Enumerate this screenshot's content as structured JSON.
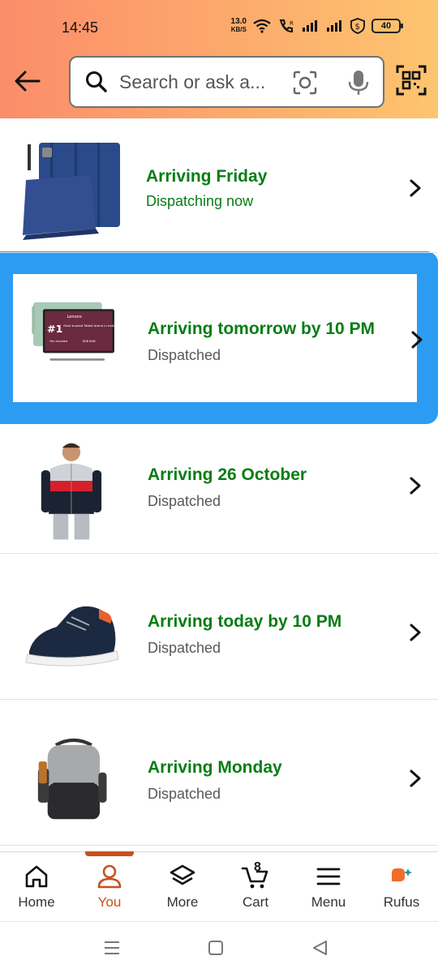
{
  "status_bar": {
    "time": "14:45",
    "net_speed_value": "13.0",
    "net_speed_unit": "KB/S",
    "battery": "40"
  },
  "search": {
    "placeholder": "Search or ask a..."
  },
  "orders": [
    {
      "title": "Arriving Friday",
      "subtitle": "Dispatching now",
      "subtitle_color": "#067d14",
      "thumb": "tablet-case"
    },
    {
      "title": "Arriving tomorrow by 10 PM",
      "subtitle": "Dispatched",
      "thumb": "lenovo-tablet",
      "thumb_text_brand": "Lenovo",
      "thumb_text_rank": "#1",
      "thumb_text_tagline": "Most trusted Tablet brand in India",
      "thumb_text_pen": "Pen Included",
      "thumb_text_ram": "8GB RAM"
    },
    {
      "title": "Arriving 26 October",
      "subtitle": "Dispatched",
      "thumb": "hoodie"
    },
    {
      "title": "Arriving today by 10 PM",
      "subtitle": "Dispatched",
      "thumb": "sneaker"
    },
    {
      "title": "Arriving Monday",
      "subtitle": "Dispatched",
      "thumb": "backpack"
    }
  ],
  "bottom_nav": [
    {
      "label": "Home",
      "icon": "home-icon"
    },
    {
      "label": "You",
      "icon": "user-icon",
      "active": true
    },
    {
      "label": "More",
      "icon": "layers-icon"
    },
    {
      "label": "Cart",
      "icon": "cart-icon",
      "count": "8"
    },
    {
      "label": "Menu",
      "icon": "menu-icon"
    },
    {
      "label": "Rufus",
      "icon": "rufus-icon"
    }
  ],
  "colors": {
    "header_gradient_start": "#fb8d6a",
    "header_gradient_end": "#fdc56f",
    "arrival_green": "#067d14",
    "highlight_blue": "#2c9bf2",
    "active_orange": "#c7511f"
  }
}
